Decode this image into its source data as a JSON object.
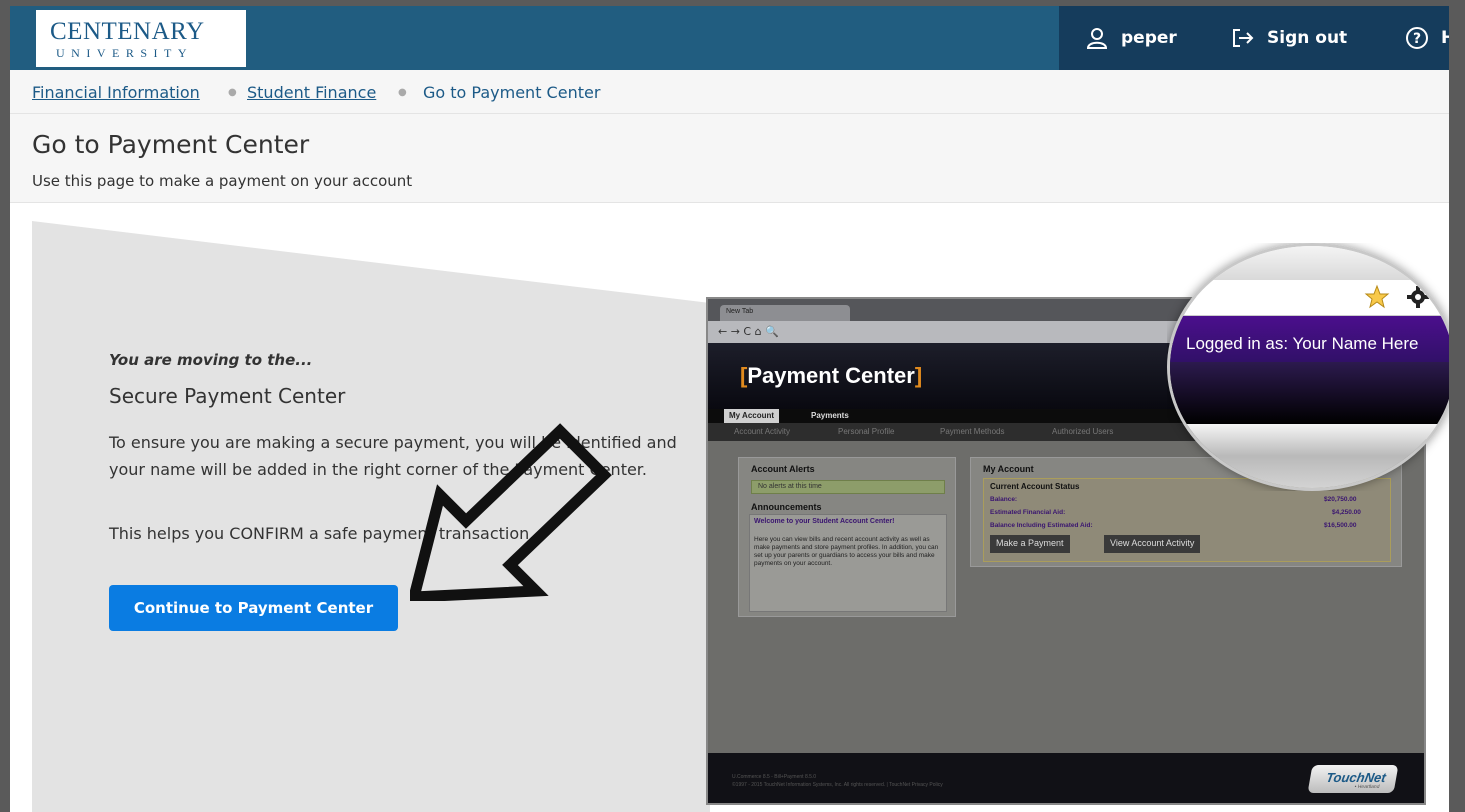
{
  "header": {
    "logo": {
      "name": "CENTENARY",
      "sub": "UNIVERSITY"
    },
    "user": {
      "label": "peper",
      "icon": "user-icon"
    },
    "signout": {
      "label": "Sign out",
      "icon": "sign-out-icon"
    },
    "help": {
      "label": "H",
      "icon": "help-icon"
    },
    "colors": {
      "bar": "#215d80",
      "right": "#153c5c"
    }
  },
  "breadcrumb": {
    "items": [
      {
        "label": "Financial Information"
      },
      {
        "label": "Student Finance"
      },
      {
        "label": "Go to Payment Center"
      }
    ]
  },
  "page": {
    "title": "Go to Payment Center",
    "subtitle": "Use this page to make a payment on your account"
  },
  "content": {
    "intro": "You are moving to the...",
    "heading": "Secure Payment Center",
    "description": "To ensure you are making a secure payment, you will be identified and your name will be added in the right corner of the Payment Center.",
    "confirm": "This helps you CONFIRM a safe payment transaction.",
    "button": "Continue to Payment Center",
    "button_color": "#0a7ce2"
  },
  "preview": {
    "browser_tab": "New Tab",
    "nav_controls": "← → C ⌂ 🔍",
    "title_bracket_open": "[",
    "title": "Payment Center",
    "title_bracket_close": "]",
    "tabs": [
      "My Account",
      "Payments"
    ],
    "subnav": [
      "Account Activity",
      "Personal Profile",
      "Payment Methods",
      "Authorized Users"
    ],
    "alerts": {
      "title": "Account Alerts",
      "message": "No alerts at this time"
    },
    "announcements": {
      "title": "Announcements",
      "welcome": "Welcome to your Student Account Center!",
      "body": "Here you can view bills and recent account activity as well as make payments and store payment profiles. In addition, you can set up your parents or guardians to access your bills and make payments on your account."
    },
    "account": {
      "title": "My Account",
      "status_title": "Current Account Status",
      "rows": [
        {
          "label": "Balance:",
          "value": "$20,750.00"
        },
        {
          "label": "Estimated Financial Aid:",
          "value": "$4,250.00"
        },
        {
          "label": "Balance Including Estimated Aid:",
          "value": "$16,500.00"
        }
      ],
      "buttons": [
        "Make a Payment",
        "View Account Activity"
      ]
    },
    "footer": {
      "line1": "U.Commerce 8.5 - Bill+Payment 8.5.0",
      "line2": "©1997 - 2015 TouchNet Information Systems, Inc. All rights reserved. | TouchNet Privacy Policy",
      "brand": "TouchNet",
      "brand_sub": "• Heartland"
    },
    "magnifier": {
      "logged_in": "Logged in as: Your Name Here"
    }
  }
}
